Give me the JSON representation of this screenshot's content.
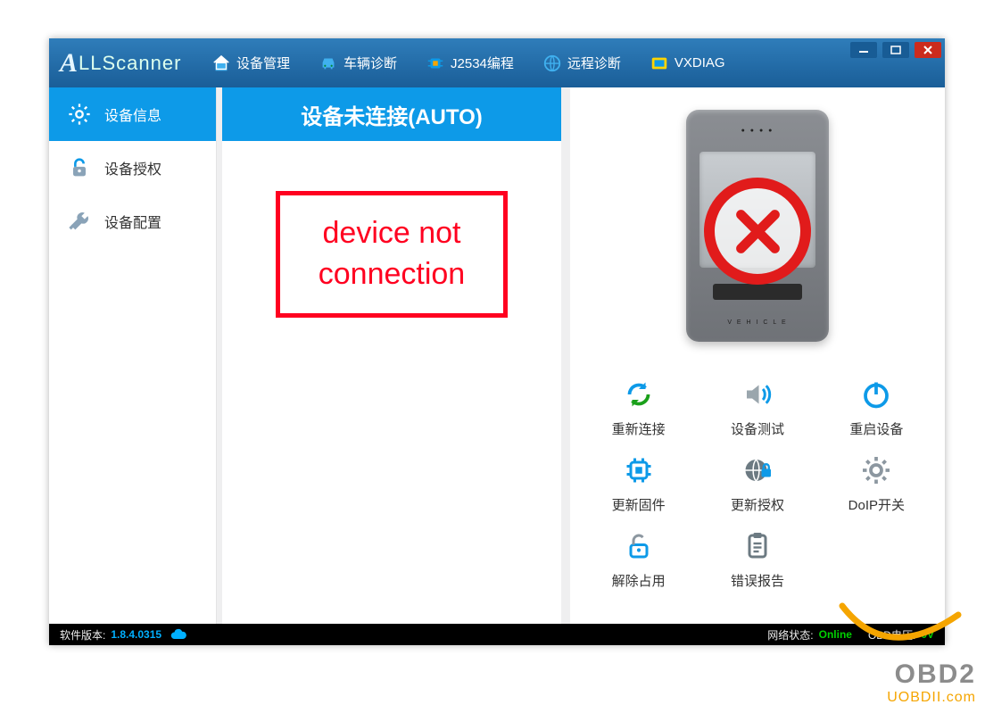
{
  "app": {
    "logo_text": "LLScanner"
  },
  "menu": {
    "items": [
      {
        "label": "设备管理",
        "icon": "home-icon"
      },
      {
        "label": "车辆诊断",
        "icon": "car-icon"
      },
      {
        "label": "J2534编程",
        "icon": "chip-icon"
      },
      {
        "label": "远程诊断",
        "icon": "globe-icon"
      },
      {
        "label": "VXDIAG",
        "icon": "vxdiag-icon"
      }
    ]
  },
  "sidebar": {
    "items": [
      {
        "label": "设备信息",
        "icon": "gear-icon",
        "active": true
      },
      {
        "label": "设备授权",
        "icon": "lock-icon",
        "active": false
      },
      {
        "label": "设备配置",
        "icon": "wrench-icon",
        "active": false
      }
    ]
  },
  "center": {
    "header": "设备未连接(AUTO)",
    "alert_line1": "device not",
    "alert_line2": "connection"
  },
  "device": {
    "status": "not_connected",
    "status_icon": "cross-circle-icon"
  },
  "actions": [
    {
      "label": "重新连接",
      "icon": "refresh-icon"
    },
    {
      "label": "设备测试",
      "icon": "speaker-icon"
    },
    {
      "label": "重启设备",
      "icon": "power-icon"
    },
    {
      "label": "更新固件",
      "icon": "firmware-icon"
    },
    {
      "label": "更新授权",
      "icon": "globe-lock-icon"
    },
    {
      "label": "DoIP开关",
      "icon": "cog-icon"
    },
    {
      "label": "解除占用",
      "icon": "unlock-icon"
    },
    {
      "label": "错误报告",
      "icon": "report-icon"
    }
  ],
  "status": {
    "version_label": "软件版本:",
    "version_value": "1.8.4.0315",
    "network_label": "网络状态:",
    "network_value": "Online",
    "obd_label": "OBD电压:",
    "obd_value": "0V"
  },
  "watermark": {
    "line1": "OBD2",
    "line2": "UOBDII.com"
  },
  "colors": {
    "accent": "#0d9ae8",
    "header_grad_top": "#2f7dba",
    "header_grad_bottom": "#1a5e98",
    "error": "#e11b1b",
    "status_green": "#00d000",
    "status_blue": "#00b0ff"
  }
}
